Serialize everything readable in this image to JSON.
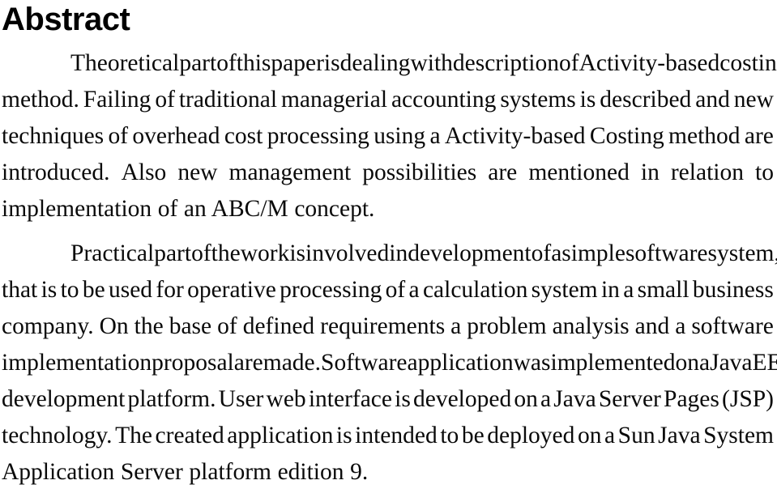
{
  "document": {
    "heading": "Abstract",
    "paragraphs": [
      {
        "id": "abstract-paragraph-1",
        "text": "Theoretical part of this paper is dealing with description of Activity-based costing method. Failing of traditional managerial accounting systems is described and new techniques of overhead cost processing using a Activity-based Costing method are introduced. Also new management possibilities are mentioned in relation to implementation of an ABC/M concept.",
        "lines": [
          {
            "id": "p1-l1",
            "indent": true,
            "justified": true,
            "words": [
              "Theoretical",
              "part",
              "of",
              "this",
              "paper",
              "is",
              "dealing",
              "with",
              "description",
              "of",
              "Activity-based",
              "costing"
            ]
          },
          {
            "id": "p1-l2",
            "indent": false,
            "justified": true,
            "words": [
              "method.",
              "Failing",
              "of",
              "traditional",
              "managerial",
              "accounting",
              "systems",
              "is",
              "described",
              "and",
              "new"
            ]
          },
          {
            "id": "p1-l3",
            "indent": false,
            "justified": true,
            "words": [
              "techniques",
              "of",
              "overhead",
              "cost",
              "processing",
              "using",
              "a",
              "Activity-based",
              "Costing",
              "method",
              "are"
            ]
          },
          {
            "id": "p1-l4",
            "indent": false,
            "justified": true,
            "words": [
              "introduced.",
              "Also",
              "new",
              "management",
              "possibilities",
              "are",
              "mentioned",
              "in",
              "relation",
              "to"
            ]
          },
          {
            "id": "p1-l5",
            "indent": false,
            "justified": false,
            "text": "implementation of an ABC/M concept."
          }
        ]
      },
      {
        "id": "abstract-paragraph-2",
        "text": "Practical part of the work is involved in development of a simple software system, that is to be used for operative processing of a calculation system in a small business company. On the base of defined requirements a problem analysis and a software implementation proposal are made. Software application was implemented on a Java EE development platform. User web interface is developed on a Java Server Pages (JSP) technology. The created application is intended to be deployed on a Sun Java System Application Server platform edition 9.",
        "lines": [
          {
            "id": "p2-l1",
            "indent": true,
            "justified": true,
            "words": [
              "Practical",
              "part",
              "of",
              "the",
              "work",
              "is",
              "involved",
              "in",
              "development",
              "of",
              "a",
              "simple",
              "software",
              "system,"
            ]
          },
          {
            "id": "p2-l2",
            "indent": false,
            "justified": true,
            "words": [
              "that",
              "is",
              "to",
              "be",
              "used",
              "for",
              "operative",
              "processing",
              "of",
              "a",
              "calculation",
              "system",
              "in",
              "a",
              "small",
              "business"
            ]
          },
          {
            "id": "p2-l3",
            "indent": false,
            "justified": true,
            "words": [
              "company.",
              "On",
              "the",
              "base",
              "of",
              "defined",
              "requirements",
              "a",
              "problem",
              "analysis",
              "and",
              "a",
              "software"
            ]
          },
          {
            "id": "p2-l4",
            "indent": false,
            "justified": true,
            "words": [
              "implementation",
              "proposal",
              "are",
              "made.",
              "Software",
              "application",
              "was",
              "implemented",
              "on",
              "a",
              "Java",
              "EE"
            ]
          },
          {
            "id": "p2-l5",
            "indent": false,
            "justified": true,
            "words": [
              "development",
              "platform.",
              "User",
              "web",
              "interface",
              "is",
              "developed",
              "on",
              "a",
              "Java",
              "Server",
              "Pages",
              "(JSP)"
            ]
          },
          {
            "id": "p2-l6",
            "indent": false,
            "justified": true,
            "words": [
              "technology.",
              "The",
              "created",
              "application",
              "is",
              "intended",
              "to",
              "be",
              "deployed",
              "on",
              "a",
              "Sun",
              "Java",
              "System"
            ]
          },
          {
            "id": "p2-l7",
            "indent": false,
            "justified": false,
            "text": "Application Server platform edition 9."
          }
        ]
      }
    ]
  }
}
